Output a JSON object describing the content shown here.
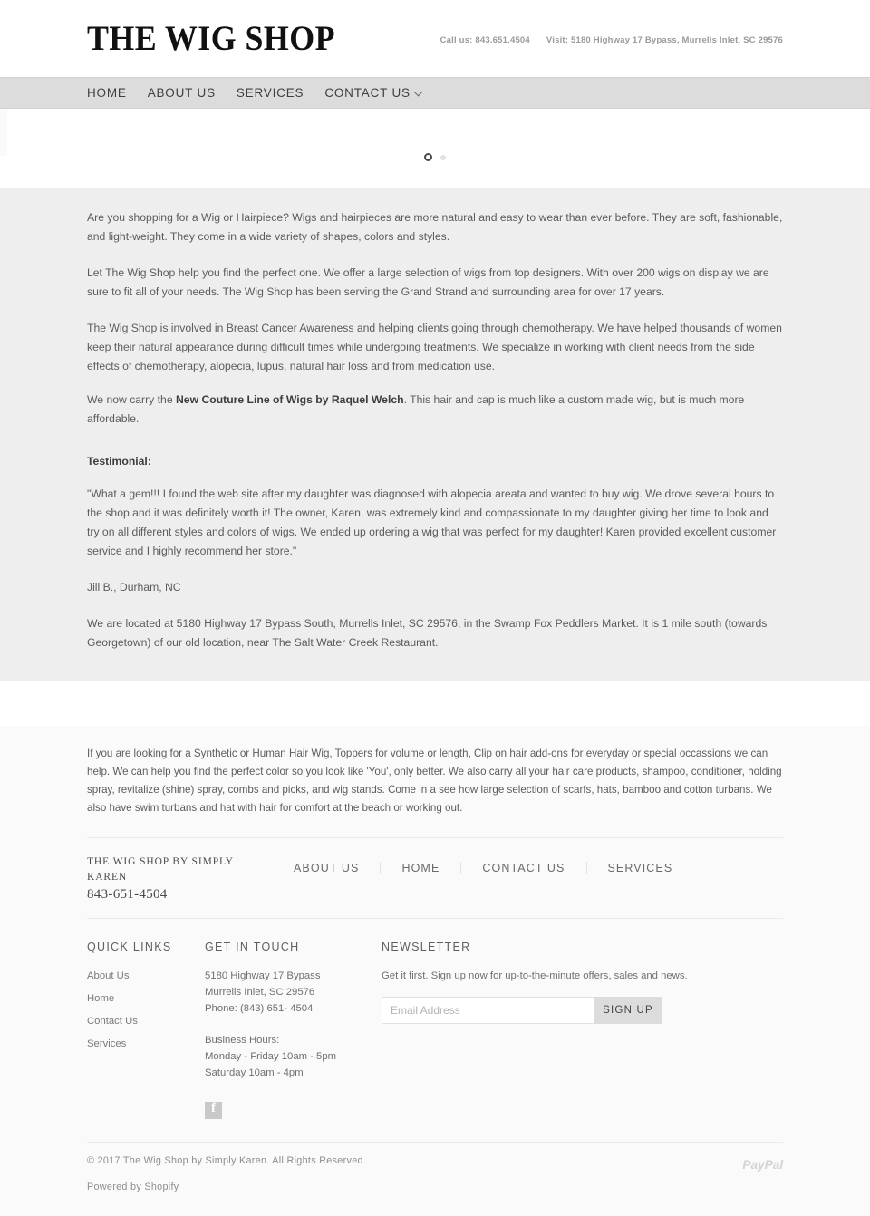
{
  "header": {
    "logo": "THE WIG SHOP",
    "call": "Call us: 843.651.4504",
    "visit": "Visit: 5180 Highway 17 Bypass, Murrells Inlet, SC 29576"
  },
  "nav": {
    "items": [
      {
        "label": "HOME",
        "has_dropdown": false
      },
      {
        "label": "ABOUT US",
        "has_dropdown": false
      },
      {
        "label": "SERVICES",
        "has_dropdown": false
      },
      {
        "label": "CONTACT US",
        "has_dropdown": true
      }
    ]
  },
  "slider": {
    "dots": [
      {
        "state": "active"
      },
      {
        "state": "inactive"
      }
    ]
  },
  "main": {
    "p1": "Are you shopping for a Wig or Hairpiece? Wigs and hairpieces are more natural and easy to wear than ever before. They are soft, fashionable, and light-weight. They come in a wide variety of shapes, colors and styles.",
    "p2": "Let The Wig Shop help you find the perfect one. We offer a large selection of wigs from top designers. With over 200 wigs on display we are sure to fit all of your needs. The Wig Shop has been serving the Grand Strand and surrounding area for over 17 years.",
    "p3": "The Wig Shop is involved in Breast Cancer Awareness and helping clients going through chemotherapy.  We have helped thousands of women keep their natural appearance during difficult times while undergoing treatments. We specialize in working with client needs from the side effects of chemotherapy, alopecia, lupus, natural hair loss and from medication use.",
    "p4_prefix": "We now carry the ",
    "p4_bold": "New Couture Line of Wigs by Raquel Welch",
    "p4_suffix": ". This hair and cap is much like a custom made wig, but is much more affordable.",
    "testimonial_heading": "Testimonial:",
    "testimonial_body": "\"What a gem!!!  I found the web site after my daughter was diagnosed with alopecia areata and wanted to buy wig.  We drove several hours to the shop and it was definitely worth it!  The owner, Karen, was extremely kind and compassionate to my daughter giving her time to look and try on all different styles and colors of wigs. We ended up ordering a wig that was perfect for my daughter!  Karen provided excellent customer service and I highly recommend her store.\"",
    "testimonial_author": "Jill B., Durham, NC",
    "location": "We are located at 5180 Highway 17 Bypass South, Murrells Inlet, SC 29576, in the Swamp Fox Peddlers Market. It is 1 mile south (towards Georgetown) of our old location, near The Salt Water Creek Restaurant."
  },
  "footer": {
    "intro": "If you are looking for a Synthetic or Human Hair Wig, Toppers for volume or length, Clip on hair add-ons for everyday or special occassions we can help. We can help you find the perfect color so you look like 'You', only better. We also carry all your hair care products, shampoo, conditioner, holding spray, revitalize (shine) spray, combs and picks, and wig stands. Come in a see how large selection of scarfs, hats, bamboo and cotton turbans. We also have swim turbans and hat with hair for comfort at the beach or working out.",
    "brand_name": "THE WIG SHOP BY SIMPLY KAREN",
    "brand_phone": "843-651-4504",
    "nav_links": [
      "ABOUT US",
      "HOME",
      "CONTACT US",
      "SERVICES"
    ],
    "quick_links": {
      "heading": "QUICK LINKS",
      "items": [
        "About Us",
        "Home",
        "Contact Us",
        "Services"
      ]
    },
    "get_in_touch": {
      "heading": "GET IN TOUCH",
      "address_line1": "5180 Highway 17 Bypass",
      "address_line2": "Murrells Inlet, SC 29576",
      "phone": "Phone: (843) 651- 4504",
      "hours_label": "Business Hours:",
      "hours_weekday": "Monday - Friday 10am - 5pm",
      "hours_saturday": "Saturday 10am - 4pm"
    },
    "newsletter": {
      "heading": "NEWSLETTER",
      "description": "Get it first. Sign up now for up-to-the-minute offers, sales and news.",
      "input_value": "",
      "input_placeholder": "Email Address",
      "button_label": "SIGN UP"
    },
    "social": {
      "facebook": "facebook-icon"
    },
    "copyright": "© 2017 The Wig Shop by Simply Karen. All Rights Reserved.",
    "powered_prefix": "Powered by ",
    "powered_link": "Shopify",
    "payment": "PayPal"
  },
  "colors": {
    "nav_bg": "#dcdcdc",
    "main_bg": "#eeeeee",
    "footer_bg": "#fafafa",
    "button_bg": "#dcdcdc"
  }
}
